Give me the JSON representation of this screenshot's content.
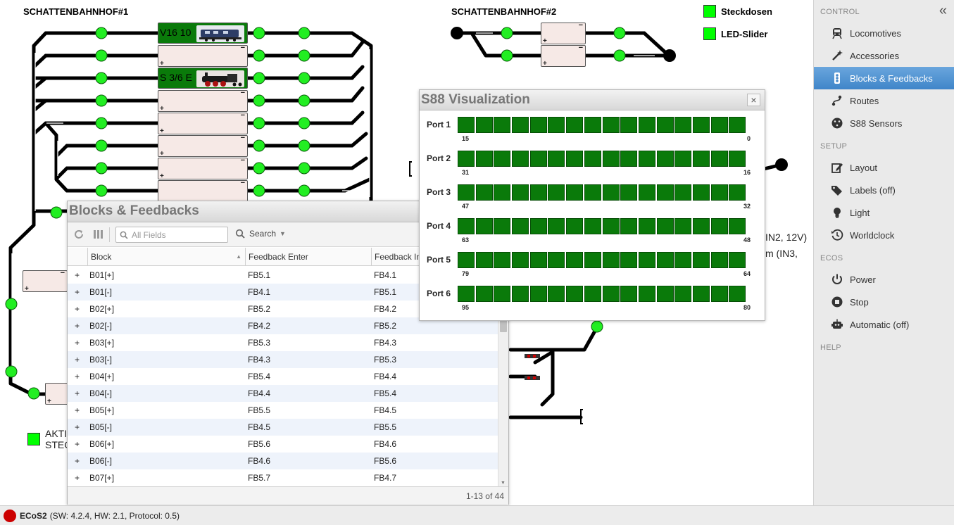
{
  "layout": {
    "station1_title": "SCHATTENBAHNHOF#1",
    "station2_title": "SCHATTENBAHNHOF#2",
    "legend": [
      {
        "label": "Steckdosen",
        "color": "#00ff00"
      },
      {
        "label": "LED-Slider",
        "color": "#00ff00"
      }
    ],
    "loco_blocks": [
      {
        "label": "V16 10"
      },
      {
        "label": "S 3/6 E"
      }
    ],
    "partial_texts": [
      "IN2, 12V)",
      "m (IN3,",
      "AKTI",
      "STEC"
    ]
  },
  "sidebar": {
    "collapse_icon": "double-chevron-left-icon",
    "sections": [
      {
        "title": "CONTROL",
        "items": [
          {
            "label": "Locomotives",
            "icon": "train-icon"
          },
          {
            "label": "Accessories",
            "icon": "magic-wand-icon"
          },
          {
            "label": "Blocks & Feedbacks",
            "icon": "traffic-light-icon",
            "active": true
          },
          {
            "label": "Routes",
            "icon": "route-icon"
          },
          {
            "label": "S88 Sensors",
            "icon": "sensor-icon"
          }
        ]
      },
      {
        "title": "SETUP",
        "items": [
          {
            "label": "Layout",
            "icon": "edit-icon"
          },
          {
            "label": "Labels (off)",
            "icon": "tags-icon"
          },
          {
            "label": "Light",
            "icon": "lightbulb-icon"
          },
          {
            "label": "Worldclock",
            "icon": "history-clock-icon"
          }
        ]
      },
      {
        "title": "ECOS",
        "items": [
          {
            "label": "Power",
            "icon": "power-icon"
          },
          {
            "label": "Stop",
            "icon": "stop-icon"
          },
          {
            "label": "Automatic (off)",
            "icon": "robot-icon"
          }
        ]
      },
      {
        "title": "HELP",
        "items": []
      }
    ]
  },
  "status": {
    "device": "ECoS2",
    "details": "(SW: 4.2.4, HW: 2.1, Protocol: 0.5)",
    "indicator_color": "#cc0000"
  },
  "blocks_dialog": {
    "title": "Blocks & Feedbacks",
    "search_placeholder": "All Fields",
    "search_label": "Search",
    "columns": [
      "Block",
      "Feedback Enter",
      "Feedback In"
    ],
    "rows": [
      {
        "expand": "+",
        "block": "B01[+]",
        "enter": "FB5.1",
        "in": "FB4.1"
      },
      {
        "expand": "+",
        "block": "B01[-]",
        "enter": "FB4.1",
        "in": "FB5.1"
      },
      {
        "expand": "+",
        "block": "B02[+]",
        "enter": "FB5.2",
        "in": "FB4.2"
      },
      {
        "expand": "+",
        "block": "B02[-]",
        "enter": "FB4.2",
        "in": "FB5.2"
      },
      {
        "expand": "+",
        "block": "B03[+]",
        "enter": "FB5.3",
        "in": "FB4.3"
      },
      {
        "expand": "+",
        "block": "B03[-]",
        "enter": "FB4.3",
        "in": "FB5.3"
      },
      {
        "expand": "+",
        "block": "B04[+]",
        "enter": "FB5.4",
        "in": "FB4.4"
      },
      {
        "expand": "+",
        "block": "B04[-]",
        "enter": "FB4.4",
        "in": "FB5.4"
      },
      {
        "expand": "+",
        "block": "B05[+]",
        "enter": "FB5.5",
        "in": "FB4.5"
      },
      {
        "expand": "+",
        "block": "B05[-]",
        "enter": "FB4.5",
        "in": "FB5.5"
      },
      {
        "expand": "+",
        "block": "B06[+]",
        "enter": "FB5.6",
        "in": "FB4.6"
      },
      {
        "expand": "+",
        "block": "B06[-]",
        "enter": "FB4.6",
        "in": "FB5.6"
      },
      {
        "expand": "+",
        "block": "B07[+]",
        "enter": "FB5.7",
        "in": "FB4.7"
      }
    ],
    "pager": "1-13 of 44"
  },
  "s88_dialog": {
    "title": "S88 Visualization",
    "close_label": "×",
    "cell_color": "#0a7a0a",
    "ports": [
      {
        "label": "Port 1",
        "high": "15",
        "low": "0",
        "states": [
          1,
          1,
          1,
          1,
          1,
          1,
          1,
          1,
          1,
          1,
          1,
          1,
          1,
          1,
          1,
          1
        ]
      },
      {
        "label": "Port 2",
        "high": "31",
        "low": "16",
        "states": [
          1,
          1,
          1,
          1,
          1,
          1,
          1,
          1,
          1,
          1,
          1,
          1,
          1,
          1,
          1,
          1
        ]
      },
      {
        "label": "Port 3",
        "high": "47",
        "low": "32",
        "states": [
          1,
          1,
          1,
          1,
          1,
          1,
          1,
          1,
          1,
          1,
          1,
          1,
          1,
          1,
          1,
          1
        ]
      },
      {
        "label": "Port 4",
        "high": "63",
        "low": "48",
        "states": [
          1,
          1,
          1,
          1,
          1,
          1,
          1,
          1,
          1,
          1,
          1,
          1,
          1,
          1,
          1,
          1
        ]
      },
      {
        "label": "Port 5",
        "high": "79",
        "low": "64",
        "states": [
          1,
          1,
          1,
          1,
          1,
          1,
          1,
          1,
          1,
          1,
          1,
          1,
          1,
          1,
          1,
          1
        ]
      },
      {
        "label": "Port 6",
        "high": "95",
        "low": "80",
        "states": [
          1,
          1,
          1,
          1,
          1,
          1,
          1,
          1,
          1,
          1,
          1,
          1,
          1,
          1,
          1,
          1
        ]
      }
    ]
  }
}
